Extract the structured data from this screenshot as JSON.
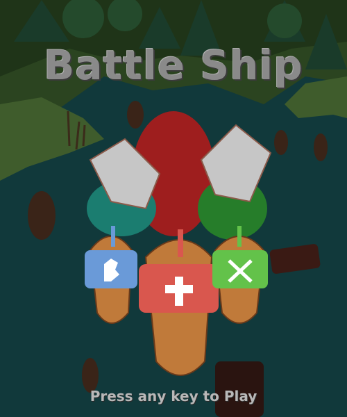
{
  "title": "Battle Ship",
  "prompt": "Press any key to Play",
  "ships": [
    {
      "name": "blue-knight-ship",
      "sail_color": "#6a9ad8",
      "emblem": "knight-icon"
    },
    {
      "name": "red-cross-ship",
      "sail_color": "#d9574e",
      "emblem": "cross-icon"
    },
    {
      "name": "green-swords-ship",
      "sail_color": "#63c24a",
      "emblem": "crossed-swords-icon"
    }
  ],
  "colors": {
    "water": "#0f3a3c",
    "land": "#3e5a2a",
    "title": "#8a8a8a"
  }
}
